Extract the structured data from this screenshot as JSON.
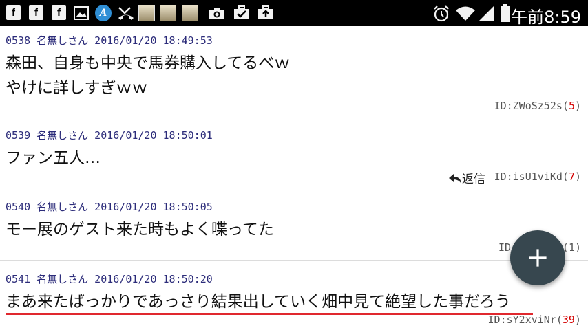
{
  "status_bar": {
    "time": "午前8:59",
    "left_icons": [
      "facebook-icon",
      "facebook-icon",
      "facebook-icon",
      "image-icon",
      "a-app-icon",
      "missed-call-icon",
      "game-app-icon",
      "game-app-icon",
      "game-app-icon",
      "camera-icon",
      "briefcase-check-icon",
      "briefcase-upload-icon"
    ],
    "right_icons": [
      "alarm-icon",
      "wifi-icon",
      "signal-icon",
      "battery-icon"
    ]
  },
  "posts": [
    {
      "header": "0538 名無しさん 2016/01/20 18:49:53",
      "lines": [
        "森田、自身も中央で馬券購入してるべｗ",
        "やけに詳しすぎｗｗ"
      ],
      "id": "ID:ZWoSz52s",
      "id_count": "5"
    },
    {
      "header": "0539 名無しさん 2016/01/20 18:50:01",
      "lines": [
        "ファン五人…"
      ],
      "reply_label": "返信",
      "id": "ID:isU1viKd",
      "id_count": "7"
    },
    {
      "header": "0540 名無しさん 2016/01/20 18:50:05",
      "lines": [
        "モー展のゲスト来た時もよく喋ってた"
      ],
      "id_prefix": "ID:",
      "id_count": "1"
    },
    {
      "header": "0541 名無しさん 2016/01/20 18:50:20",
      "lines": [
        "まあ来たばっかりであっさり結果出していく畑中見て絶望した事だろう"
      ],
      "id": "ID:sY2xviNr",
      "id_count": "39"
    }
  ],
  "fab": {
    "icon": "plus-icon",
    "color": "#37474f"
  },
  "highlight_color": "#e0282e"
}
